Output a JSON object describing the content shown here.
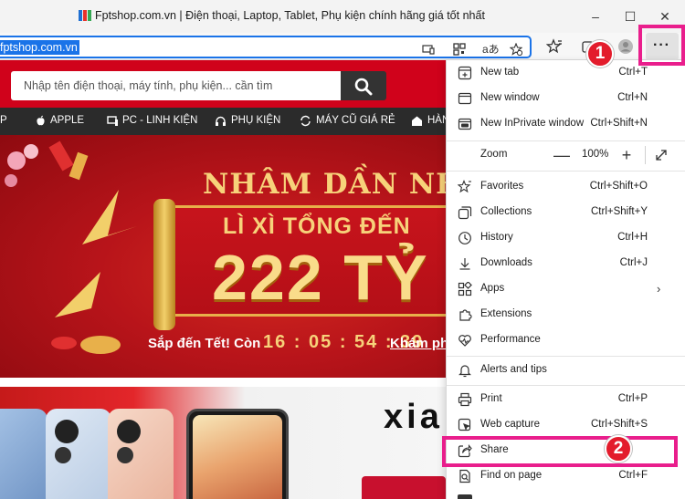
{
  "window": {
    "title": "Fptshop.com.vn | Điện thoại, Laptop, Tablet, Phụ kiện chính hãng giá tốt nhất",
    "favicon": "fpt-logo-icon",
    "controls": {
      "minimize": "–",
      "maximize": "☐",
      "close": "✕"
    }
  },
  "address_bar": {
    "url": "fptshop.com.vn",
    "icons": [
      "app-available-icon",
      "qr-code-icon",
      "read-aloud-icon",
      "favorite-add-icon"
    ],
    "read_aloud_glyph": "aあ"
  },
  "toolbar": {
    "icons": [
      "favorites-icon",
      "collections-icon",
      "profile-icon",
      "more-icon"
    ],
    "more_label": "···"
  },
  "page": {
    "search_placeholder": "Nhập tên điện thoại, máy tính, phụ kiện... cần tìm",
    "nav": [
      "P",
      "APPLE",
      "PC - LINH KIỆN",
      "PHỤ KIỆN",
      "MÁY CŨ GIÁ RẺ",
      "HÀN"
    ],
    "banner": {
      "headline": "NHÂM DẦN NHƯ Ý",
      "subhead": "LÌ XÌ TỔNG ĐẾN",
      "amount": "222 TỶ",
      "countdown_label": "Sắp đến Tết! Còn",
      "countdown": "16 : 05 : 54 : 39",
      "link": "Khám ph"
    },
    "promo_brand": "xia"
  },
  "menu": {
    "items": [
      {
        "label": "New tab",
        "shortcut": "Ctrl+T",
        "icon": "new-tab-icon"
      },
      {
        "label": "New window",
        "shortcut": "Ctrl+N",
        "icon": "new-window-icon"
      },
      {
        "label": "New InPrivate window",
        "shortcut": "Ctrl+Shift+N",
        "icon": "inprivate-icon"
      },
      {
        "label": "Zoom",
        "icon": ""
      },
      {
        "label": "Favorites",
        "shortcut": "Ctrl+Shift+O",
        "icon": "favorites-icon"
      },
      {
        "label": "Collections",
        "shortcut": "Ctrl+Shift+Y",
        "icon": "collections-icon"
      },
      {
        "label": "History",
        "shortcut": "Ctrl+H",
        "icon": "history-icon"
      },
      {
        "label": "Downloads",
        "shortcut": "Ctrl+J",
        "icon": "downloads-icon"
      },
      {
        "label": "Apps",
        "shortcut": "",
        "icon": "apps-icon"
      },
      {
        "label": "Extensions",
        "shortcut": "",
        "icon": "extensions-icon"
      },
      {
        "label": "Performance",
        "shortcut": "",
        "icon": "performance-icon"
      },
      {
        "label": "Alerts and tips",
        "shortcut": "",
        "icon": "alerts-icon"
      },
      {
        "label": "Print",
        "shortcut": "Ctrl+P",
        "icon": "print-icon"
      },
      {
        "label": "Web capture",
        "shortcut": "Ctrl+Shift+S",
        "icon": "web-capture-icon"
      },
      {
        "label": "Share",
        "shortcut": "",
        "icon": "share-icon"
      },
      {
        "label": "Find on page",
        "shortcut": "Ctrl+F",
        "icon": "find-icon"
      }
    ],
    "zoom": {
      "minus": "—",
      "value": "100%",
      "plus": "+"
    },
    "apps_arrow": "›"
  },
  "annotations": {
    "step1": "1",
    "step2": "2",
    "color": "#e91e8c"
  }
}
